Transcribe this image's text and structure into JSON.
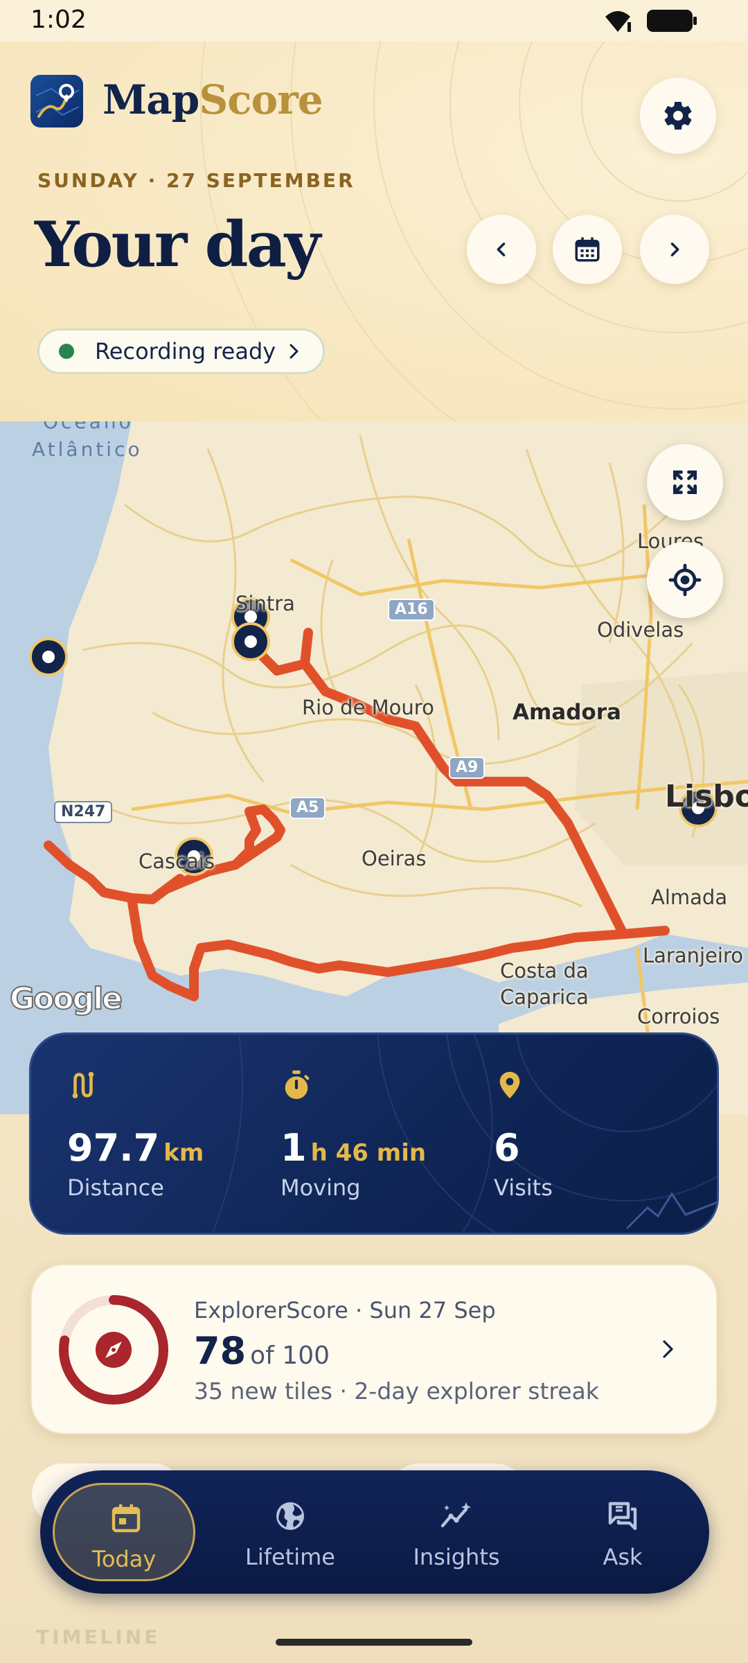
{
  "status_bar": {
    "time": "1:02"
  },
  "header": {
    "app_name_part1": "Map",
    "app_name_part2": "Score",
    "date_label": "SUNDAY · 27 SEPTEMBER",
    "title": "Your day",
    "recording_label": "Recording ready",
    "recording_status_color": "#26844f"
  },
  "map": {
    "labels": {
      "ocean_line1": "Oceano",
      "ocean_line2": "Atlântico",
      "sintra": "Sintra",
      "loures": "Loures",
      "odivelas": "Odivelas",
      "rio_de_mouro": "Rio de Mouro",
      "amadora": "Amadora",
      "oeiras": "Oeiras",
      "cascais": "Cascais",
      "lisboa": "Lisboa",
      "almada": "Almada",
      "laranjeiro": "Laranjeiro",
      "costa_da_caparica_line1": "Costa da",
      "costa_da_caparica_line2": "Caparica",
      "corroios": "Corroios"
    },
    "roads": {
      "a16": "A16",
      "a9": "A9",
      "a5": "A5",
      "n247": "N247"
    },
    "attribution": "Google",
    "route_color": "#e0512b"
  },
  "stats": [
    {
      "value": "97.7",
      "unit": "km",
      "label": "Distance",
      "icon": "route-icon"
    },
    {
      "value": "1",
      "unit": "h 46 min",
      "label": "Moving",
      "icon": "stopwatch-icon"
    },
    {
      "value": "6",
      "unit": "",
      "label": "Visits",
      "icon": "map-pin-icon"
    }
  ],
  "score": {
    "title": "ExplorerScore · Sun 27 Sep",
    "value": "78",
    "total": "of 100",
    "progress": 0.78,
    "subtitle": "35 new tiles · 2-day explorer streak",
    "ring_color": "#a8262c"
  },
  "timeline": {
    "heading": "TIMELINE"
  },
  "nav": [
    {
      "label": "Today",
      "icon": "calendar-icon",
      "active": true
    },
    {
      "label": "Lifetime",
      "icon": "globe-icon",
      "active": false
    },
    {
      "label": "Insights",
      "icon": "sparkline-icon",
      "active": false
    },
    {
      "label": "Ask",
      "icon": "chat-icon",
      "active": false
    }
  ],
  "colors": {
    "navy": "#13244a",
    "gold": "#b8913c",
    "accent_gold": "#e3b84a"
  }
}
